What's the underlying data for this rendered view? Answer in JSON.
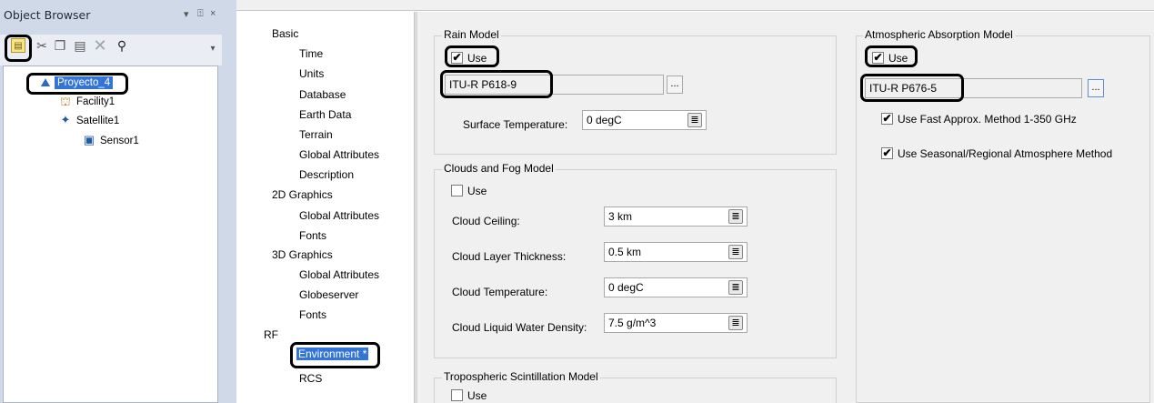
{
  "object_browser": {
    "title": "Object Browser",
    "pin_glyph": "▾",
    "dock_glyph": "⍐",
    "close_glyph": "×",
    "toolbar_icons": [
      "new-object-icon",
      "cut-icon",
      "copy-icon",
      "paste-icon",
      "delete-icon",
      "find-icon",
      "overflow-icon"
    ],
    "tree": {
      "scenario": "Proyecto_4",
      "items": [
        "Facility1",
        "Satellite1",
        "Sensor1"
      ]
    }
  },
  "categories": {
    "basic": "Basic",
    "basic_items": [
      "Time",
      "Units",
      "Database",
      "Earth Data",
      "Terrain",
      "Global Attributes",
      "Description"
    ],
    "graphics2d": "2D Graphics",
    "graphics2d_items": [
      "Global Attributes",
      "Fonts"
    ],
    "graphics3d": "3D Graphics",
    "graphics3d_items": [
      "Global Attributes",
      "Globeserver",
      "Fonts"
    ],
    "rf": "RF",
    "rf_selected": "Environment *",
    "rf_items": [
      "RCS"
    ]
  },
  "rain_model": {
    "title": "Rain Model",
    "use_label": "Use",
    "use_checked": true,
    "model": "ITU-R P618-9",
    "browse_label": "...",
    "surface_temp_label": "Surface Temperature:",
    "surface_temp_value": "0 degC"
  },
  "clouds_model": {
    "title": "Clouds and Fog Model",
    "use_label": "Use",
    "use_checked": false,
    "ceiling_label": "Cloud Ceiling:",
    "ceiling_value": "3 km",
    "thickness_label": "Cloud Layer Thickness:",
    "thickness_value": "0.5 km",
    "temperature_label": "Cloud Temperature:",
    "temperature_value": "0 degC",
    "density_label": "Cloud Liquid Water Density:",
    "density_value": "7.5 g/m^3"
  },
  "tropo_model": {
    "title": "Tropospheric Scintillation Model",
    "use_label": "Use",
    "use_checked": false
  },
  "atmos_model": {
    "title": "Atmospheric Absorption Model",
    "use_label": "Use",
    "use_checked": true,
    "model": "ITU-R P676-5",
    "browse_label": "...",
    "fast_approx_label": "Use Fast Approx. Method 1-350 GHz",
    "fast_approx_checked": true,
    "seasonal_label": "Use Seasonal/Regional Atmosphere Method",
    "seasonal_checked": true
  },
  "check_glyph": "✔",
  "spin_glyph": "≣",
  "colors": {
    "selection": "#3474d6",
    "panel_bg": "#cfd9e7",
    "dialog_bg": "#f0f0f0",
    "highlight_outline": "#000000"
  }
}
